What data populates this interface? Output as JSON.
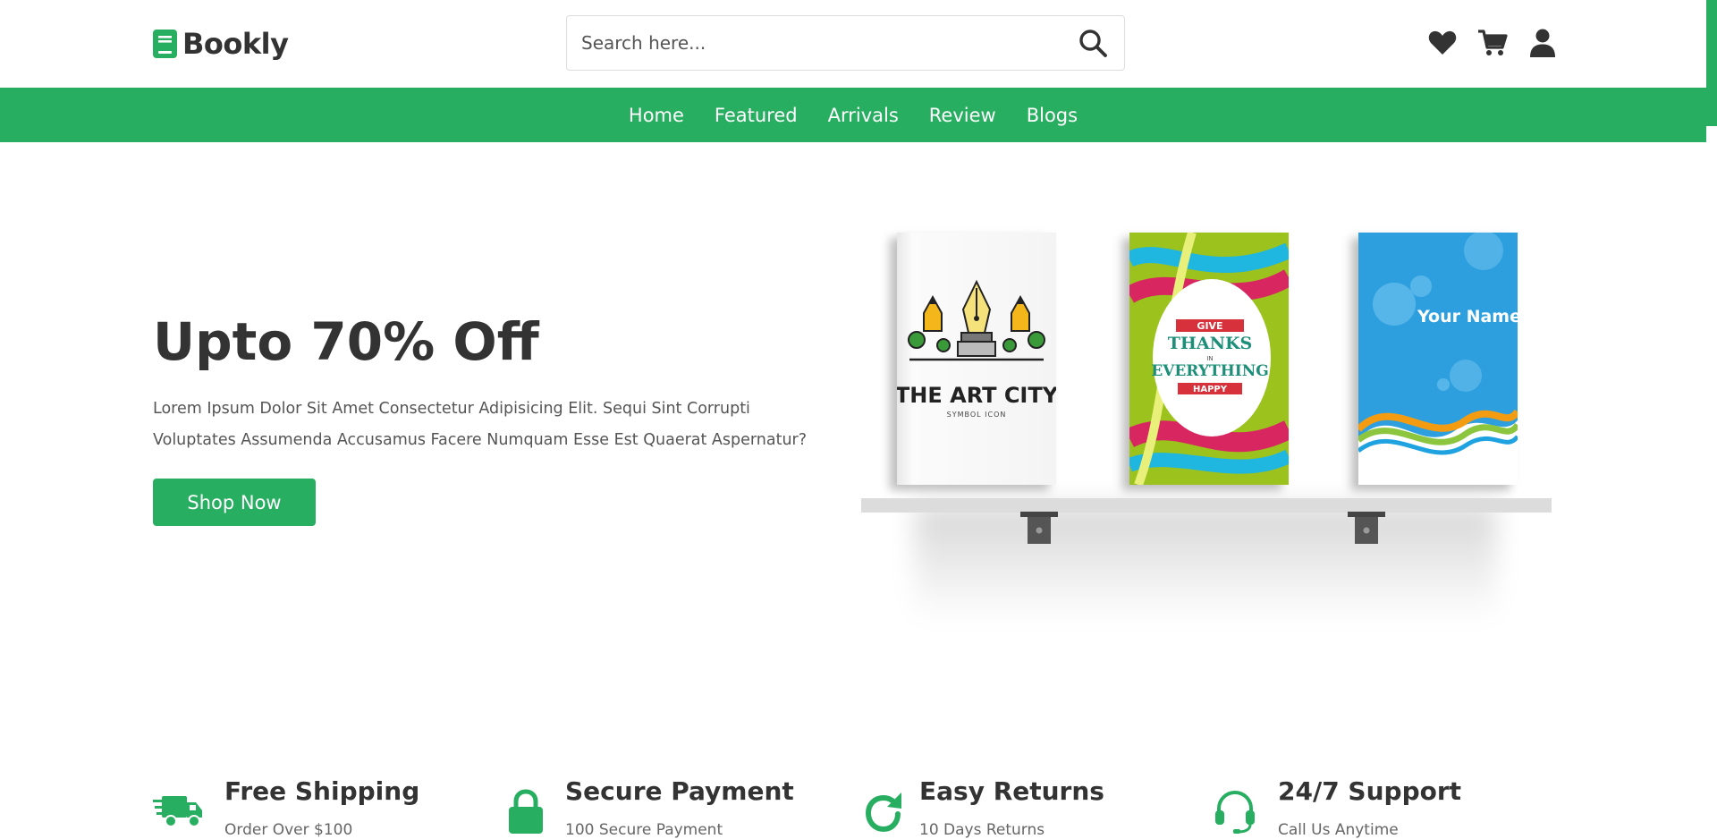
{
  "brand": {
    "name": "Bookly",
    "accent": "#27ae60",
    "text": "#333333"
  },
  "search": {
    "placeholder": "Search here..."
  },
  "header_icons": [
    "heart-icon",
    "cart-icon",
    "user-icon"
  ],
  "nav": {
    "items": [
      "Home",
      "Featured",
      "Arrivals",
      "Review",
      "Blogs"
    ]
  },
  "hero": {
    "title": "Upto 70% Off",
    "description": "Lorem Ipsum Dolor Sit Amet Consectetur Adipisicing Elit. Sequi Sint Corrupti Voluptates Assumenda Accusamus Facere Numquam Esse Est Quaerat Aspernatur?",
    "button_label": "Shop Now",
    "books": [
      {
        "title": "THE ART CITY",
        "subtitle": "SYMBOL ICON"
      },
      {
        "lines": [
          "GIVE",
          "THANKS",
          "IN",
          "EVERYTHING",
          "HAPPY"
        ]
      },
      {
        "title": "Your Name"
      }
    ]
  },
  "features": [
    {
      "title": "Free Shipping",
      "subtitle": "Order Over $100",
      "icon": "truck-icon"
    },
    {
      "title": "Secure Payment",
      "subtitle": "100 Secure Payment",
      "icon": "lock-icon"
    },
    {
      "title": "Easy Returns",
      "subtitle": "10 Days Returns",
      "icon": "redo-icon"
    },
    {
      "title": "24/7 Support",
      "subtitle": "Call Us Anytime",
      "icon": "headset-icon"
    }
  ]
}
